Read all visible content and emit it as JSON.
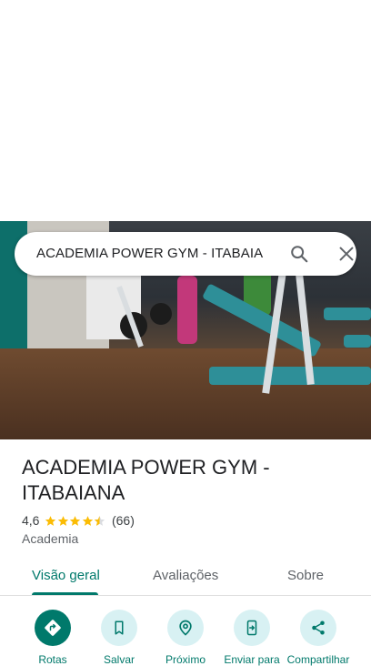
{
  "search": {
    "query": "ACADEMIA POWER GYM - ITABAIANA"
  },
  "place": {
    "name": "ACADEMIA POWER GYM - ITABAIANA",
    "rating": "4,6",
    "stars": 4.6,
    "reviews": "(66)",
    "category": "Academia"
  },
  "tabs": [
    {
      "label": "Visão geral",
      "active": true
    },
    {
      "label": "Avaliações",
      "active": false
    },
    {
      "label": "Sobre",
      "active": false
    }
  ],
  "actions": [
    {
      "label": "Rotas",
      "icon": "directions-icon"
    },
    {
      "label": "Salvar",
      "icon": "bookmark-icon"
    },
    {
      "label": "Próximo",
      "icon": "nearby-icon"
    },
    {
      "label": "Enviar para",
      "icon": "send-to-phone-icon"
    },
    {
      "label": "Compartilhar",
      "icon": "share-icon"
    }
  ],
  "colors": {
    "accent": "#00796b",
    "accent_light": "#d8f1f3",
    "star": "#fbbc04"
  }
}
